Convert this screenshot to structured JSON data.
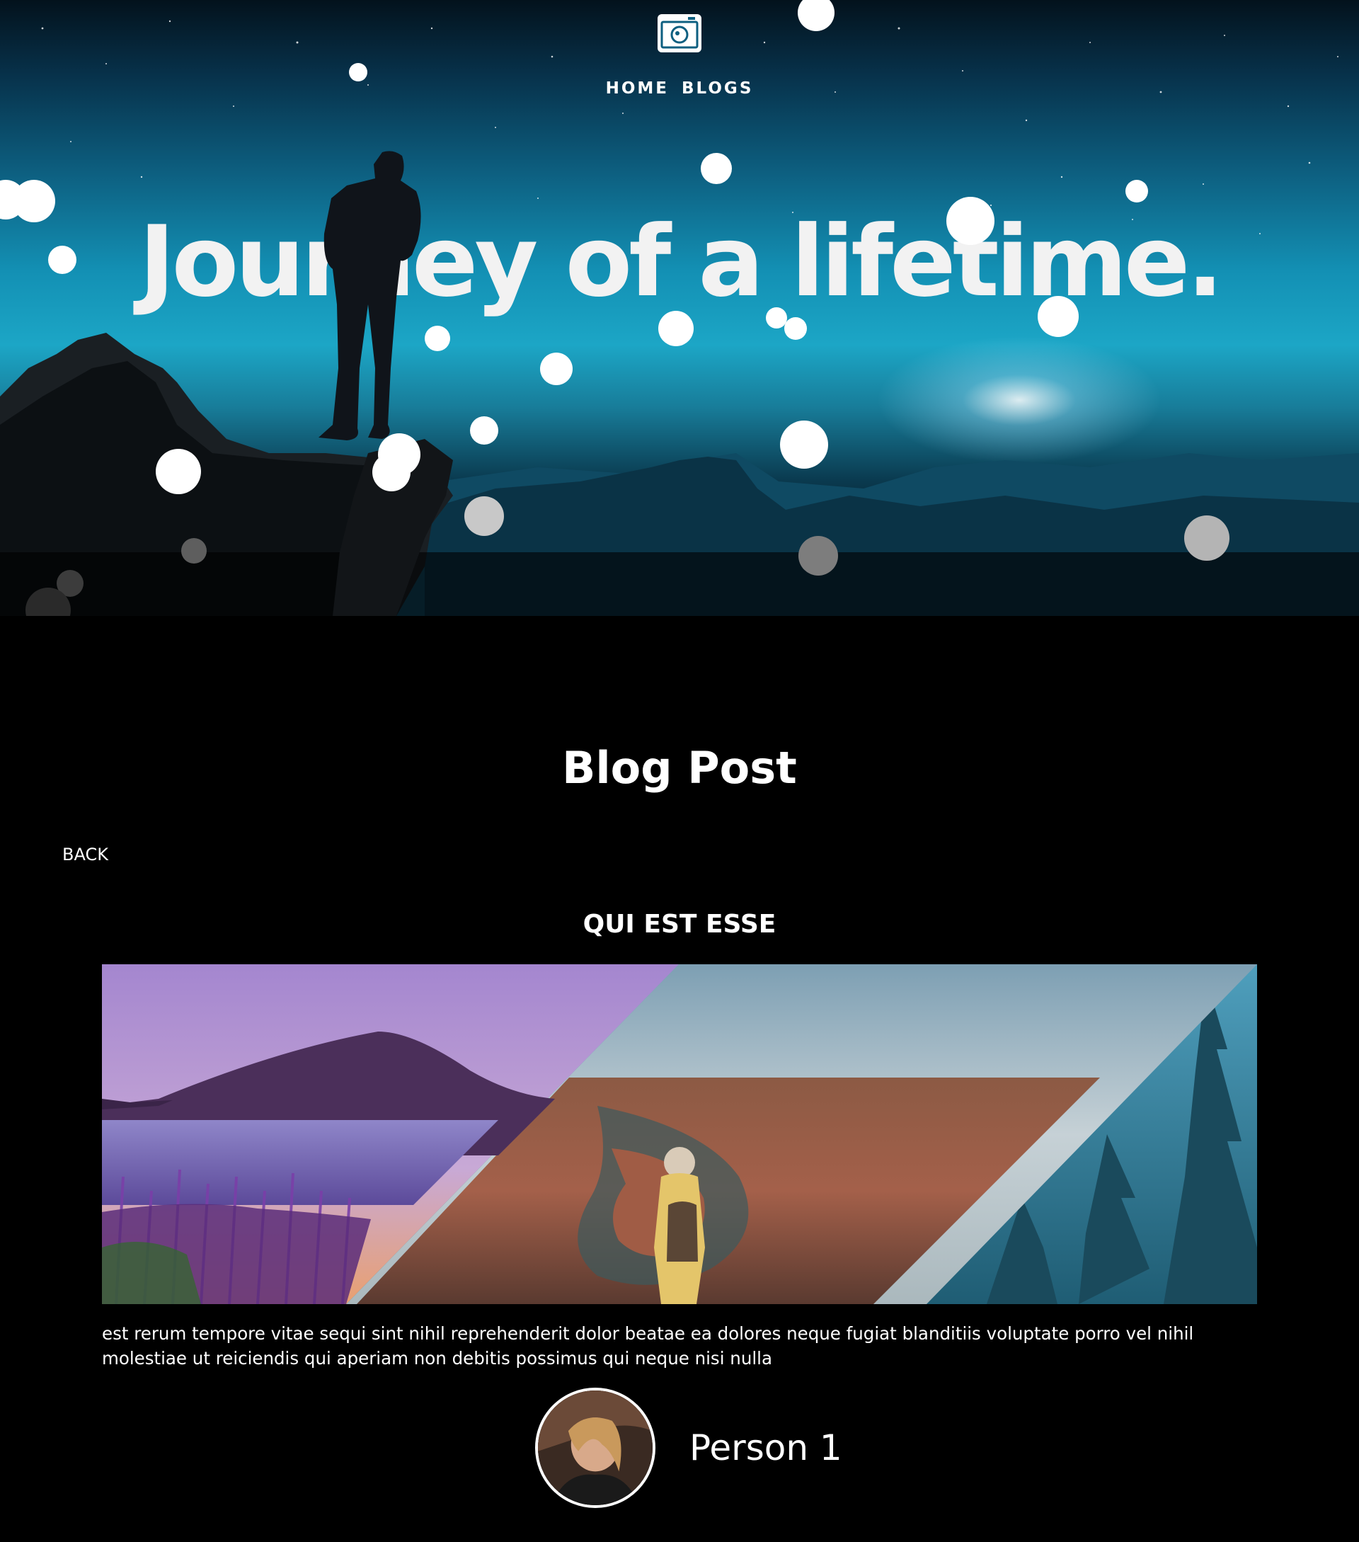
{
  "nav": {
    "items": [
      "HOME",
      "BLOGS"
    ]
  },
  "hero": {
    "title": "Journey of a lifetime."
  },
  "page": {
    "section_title": "Blog Post",
    "back_label": "BACK"
  },
  "post": {
    "title": "QUI EST ESSE",
    "body": "est rerum tempore vitae sequi sint nihil reprehenderit dolor beatae ea dolores neque fugiat blanditiis voluptate porro vel nihil molestiae ut reiciendis qui aperiam non debitis possimus qui neque nisi nulla",
    "author": "Person 1"
  },
  "colors": {
    "background": "#000000",
    "text": "#ffffff",
    "sky_accent": "#1ca6c6"
  },
  "icons": {
    "logo": "camera-icon"
  }
}
